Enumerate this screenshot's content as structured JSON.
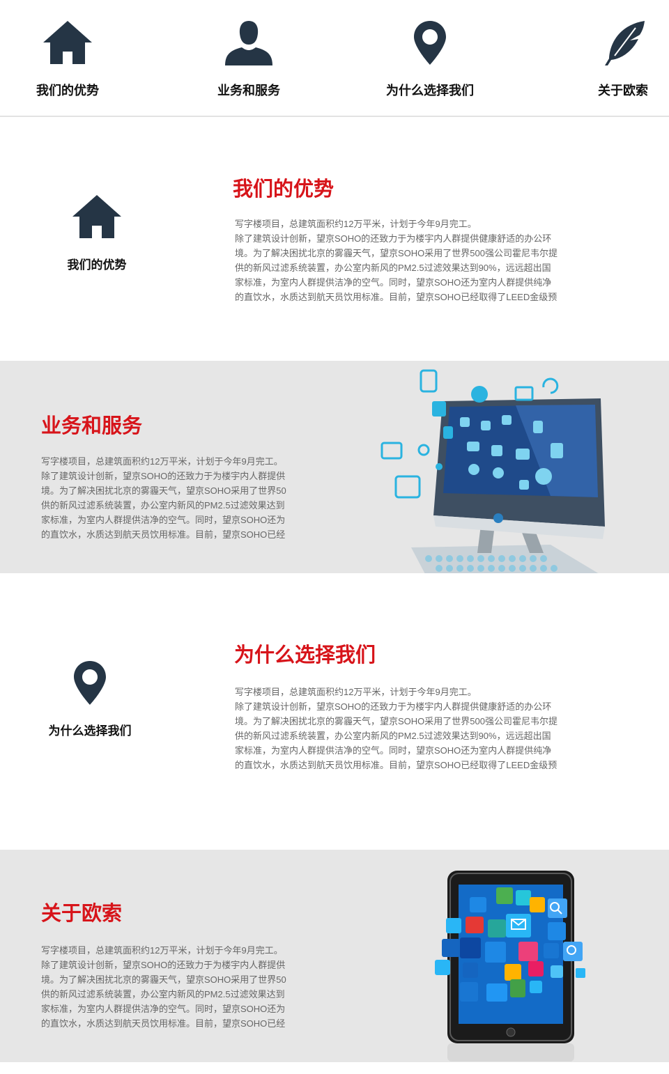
{
  "nav": {
    "items": [
      {
        "label": "我们的优势",
        "icon": "home-icon"
      },
      {
        "label": "业务和服务",
        "icon": "person-icon"
      },
      {
        "label": "为什么选择我们",
        "icon": "map-pin-icon"
      },
      {
        "label": "关于欧索",
        "icon": "feather-icon"
      }
    ]
  },
  "sections": [
    {
      "title": "我们的优势",
      "icon_label": "我们的优势",
      "icon": "home-icon",
      "lines": [
        "写字楼项目，总建筑面积约12万平米，计划于今年9月完工。",
        "除了建筑设计创新，望京SOHO的还致力于为楼宇内人群提供健康舒适的办公环",
        "境。为了解决困扰北京的雾霾天气，望京SOHO采用了世界500强公司霍尼韦尔提",
        "供的新风过滤系统装置，办公室内新风的PM2.5过滤效果达到90%，远远超出国",
        "家标准，为室内人群提供洁净的空气。同时，望京SOHO还为室内人群提供纯净",
        "的直饮水，水质达到航天员饮用标准。目前，望京SOHO已经取得了LEED金级预"
      ]
    },
    {
      "title": "业务和服务",
      "illustration": "computer-monitor-illustration",
      "lines": [
        "写字楼项目，总建筑面积约12万平米，计划于今年9月完工。",
        "除了建筑设计创新，望京SOHO的还致力于为楼宇内人群提供",
        "境。为了解决困扰北京的雾霾天气，望京SOHO采用了世界50",
        "供的新风过滤系统装置，办公室内新风的PM2.5过滤效果达到",
        "家标准，为室内人群提供洁净的空气。同时，望京SOHO还为",
        "的直饮水，水质达到航天员饮用标准。目前，望京SOHO已经"
      ]
    },
    {
      "title": "为什么选择我们",
      "icon_label": "为什么选择我们",
      "icon": "map-pin-icon",
      "lines": [
        "写字楼项目，总建筑面积约12万平米，计划于今年9月完工。",
        "除了建筑设计创新，望京SOHO的还致力于为楼宇内人群提供健康舒适的办公环",
        "境。为了解决困扰北京的雾霾天气，望京SOHO采用了世界500强公司霍尼韦尔提",
        "供的新风过滤系统装置，办公室内新风的PM2.5过滤效果达到90%，远远超出国",
        "家标准，为室内人群提供洁净的空气。同时，望京SOHO还为室内人群提供纯净",
        "的直饮水，水质达到航天员饮用标准。目前，望京SOHO已经取得了LEED金级预"
      ]
    },
    {
      "title": "关于欧索",
      "illustration": "tablet-apps-illustration",
      "lines": [
        "写字楼项目，总建筑面积约12万平米，计划于今年9月完工。",
        "除了建筑设计创新，望京SOHO的还致力于为楼宇内人群提供",
        "境。为了解决困扰北京的雾霾天气，望京SOHO采用了世界50",
        "供的新风过滤系统装置，办公室内新风的PM2.5过滤效果达到",
        "家标准，为室内人群提供洁净的空气。同时，望京SOHO还为",
        "的直饮水，水质达到航天员饮用标准。目前，望京SOHO已经"
      ]
    }
  ],
  "colors": {
    "accent_red": "#d7141a",
    "icon_dark": "#253545",
    "band_gray": "#e6e6e6",
    "body_text": "#666666"
  }
}
